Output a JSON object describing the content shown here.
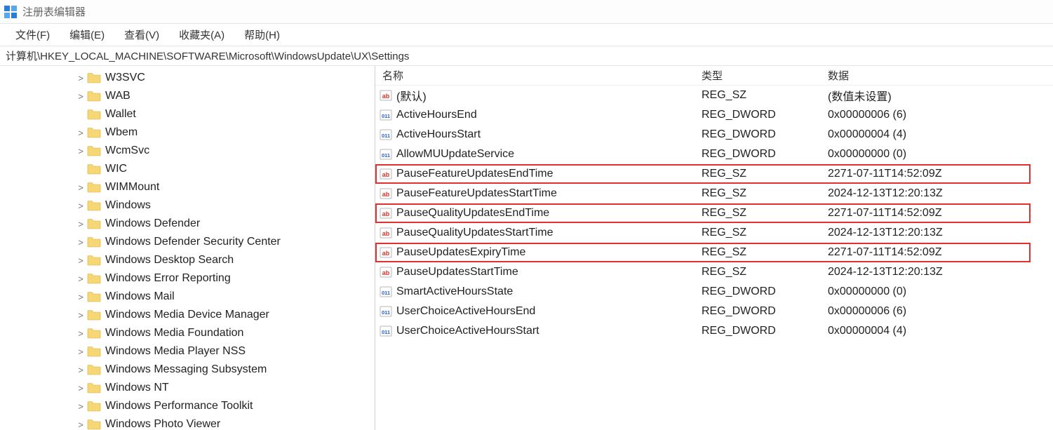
{
  "window": {
    "title": "注册表编辑器"
  },
  "menubar": {
    "file": "文件(F)",
    "edit": "编辑(E)",
    "view": "查看(V)",
    "favorites": "收藏夹(A)",
    "help": "帮助(H)"
  },
  "address": "计算机\\HKEY_LOCAL_MACHINE\\SOFTWARE\\Microsoft\\WindowsUpdate\\UX\\Settings",
  "tree": {
    "items": [
      {
        "label": "W3SVC",
        "expandable": true
      },
      {
        "label": "WAB",
        "expandable": true
      },
      {
        "label": "Wallet",
        "expandable": false
      },
      {
        "label": "Wbem",
        "expandable": true
      },
      {
        "label": "WcmSvc",
        "expandable": true
      },
      {
        "label": "WIC",
        "expandable": false
      },
      {
        "label": "WIMMount",
        "expandable": true
      },
      {
        "label": "Windows",
        "expandable": true
      },
      {
        "label": "Windows Defender",
        "expandable": true
      },
      {
        "label": "Windows Defender Security Center",
        "expandable": true
      },
      {
        "label": "Windows Desktop Search",
        "expandable": true
      },
      {
        "label": "Windows Error Reporting",
        "expandable": true
      },
      {
        "label": "Windows Mail",
        "expandable": true
      },
      {
        "label": "Windows Media Device Manager",
        "expandable": true
      },
      {
        "label": "Windows Media Foundation",
        "expandable": true
      },
      {
        "label": "Windows Media Player NSS",
        "expandable": true
      },
      {
        "label": "Windows Messaging Subsystem",
        "expandable": true
      },
      {
        "label": "Windows NT",
        "expandable": true
      },
      {
        "label": "Windows Performance Toolkit",
        "expandable": true
      },
      {
        "label": "Windows Photo Viewer",
        "expandable": true
      }
    ]
  },
  "list": {
    "headers": {
      "name": "名称",
      "type": "类型",
      "data": "数据"
    },
    "rows": [
      {
        "icon": "sz",
        "name": "(默认)",
        "type": "REG_SZ",
        "data": "(数值未设置)",
        "hl": false
      },
      {
        "icon": "dw",
        "name": "ActiveHoursEnd",
        "type": "REG_DWORD",
        "data": "0x00000006 (6)",
        "hl": false
      },
      {
        "icon": "dw",
        "name": "ActiveHoursStart",
        "type": "REG_DWORD",
        "data": "0x00000004 (4)",
        "hl": false
      },
      {
        "icon": "dw",
        "name": "AllowMUUpdateService",
        "type": "REG_DWORD",
        "data": "0x00000000 (0)",
        "hl": false
      },
      {
        "icon": "sz",
        "name": "PauseFeatureUpdatesEndTime",
        "type": "REG_SZ",
        "data": "2271-07-11T14:52:09Z",
        "hl": true
      },
      {
        "icon": "sz",
        "name": "PauseFeatureUpdatesStartTime",
        "type": "REG_SZ",
        "data": "2024-12-13T12:20:13Z",
        "hl": false
      },
      {
        "icon": "sz",
        "name": "PauseQualityUpdatesEndTime",
        "type": "REG_SZ",
        "data": "2271-07-11T14:52:09Z",
        "hl": true
      },
      {
        "icon": "sz",
        "name": "PauseQualityUpdatesStartTime",
        "type": "REG_SZ",
        "data": "2024-12-13T12:20:13Z",
        "hl": false
      },
      {
        "icon": "sz",
        "name": "PauseUpdatesExpiryTime",
        "type": "REG_SZ",
        "data": "2271-07-11T14:52:09Z",
        "hl": true
      },
      {
        "icon": "sz",
        "name": "PauseUpdatesStartTime",
        "type": "REG_SZ",
        "data": "2024-12-13T12:20:13Z",
        "hl": false
      },
      {
        "icon": "dw",
        "name": "SmartActiveHoursState",
        "type": "REG_DWORD",
        "data": "0x00000000 (0)",
        "hl": false
      },
      {
        "icon": "dw",
        "name": "UserChoiceActiveHoursEnd",
        "type": "REG_DWORD",
        "data": "0x00000006 (6)",
        "hl": false
      },
      {
        "icon": "dw",
        "name": "UserChoiceActiveHoursStart",
        "type": "REG_DWORD",
        "data": "0x00000004 (4)",
        "hl": false
      }
    ]
  }
}
